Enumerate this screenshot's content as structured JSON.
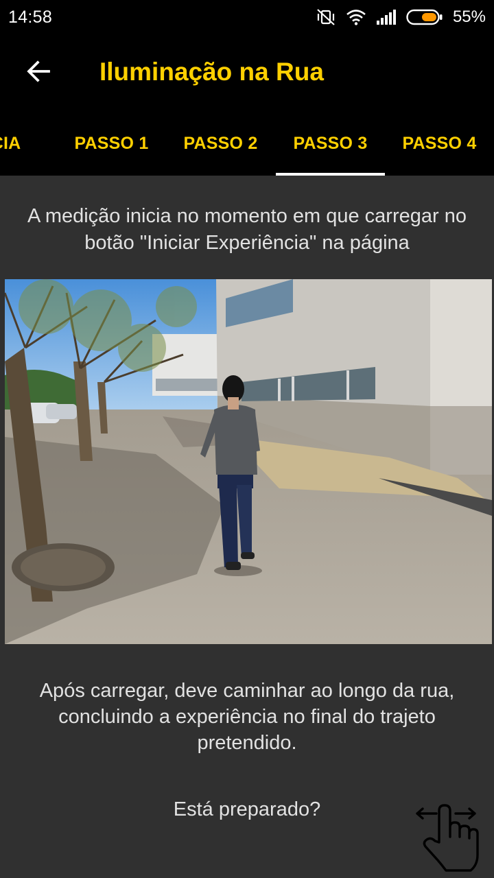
{
  "status_bar": {
    "time": "14:58",
    "battery_percent": "55%",
    "icons": [
      "vibrate-off-icon",
      "wifi-icon",
      "signal-icon",
      "battery-icon"
    ],
    "battery_color": "#ff9800"
  },
  "app_bar": {
    "title": "Iluminação na Rua",
    "back_icon": "arrow-left-icon",
    "accent_color": "#ffd000"
  },
  "tabs": [
    {
      "label": "NCIA",
      "active": false
    },
    {
      "label": "PASSO 1",
      "active": false
    },
    {
      "label": "PASSO 2",
      "active": false
    },
    {
      "label": "PASSO 3",
      "active": true
    },
    {
      "label": "PASSO 4",
      "active": false
    }
  ],
  "content": {
    "intro": "A medição inicia no momento em que carregar no botão \"Iniciar Experiência\" na página",
    "after": "Após carregar, deve caminhar ao longo da rua, concluindo a experiência no final do trajeto pretendido.",
    "ready": "Está preparado?",
    "swipe_icon": "swipe-hand-icon"
  }
}
